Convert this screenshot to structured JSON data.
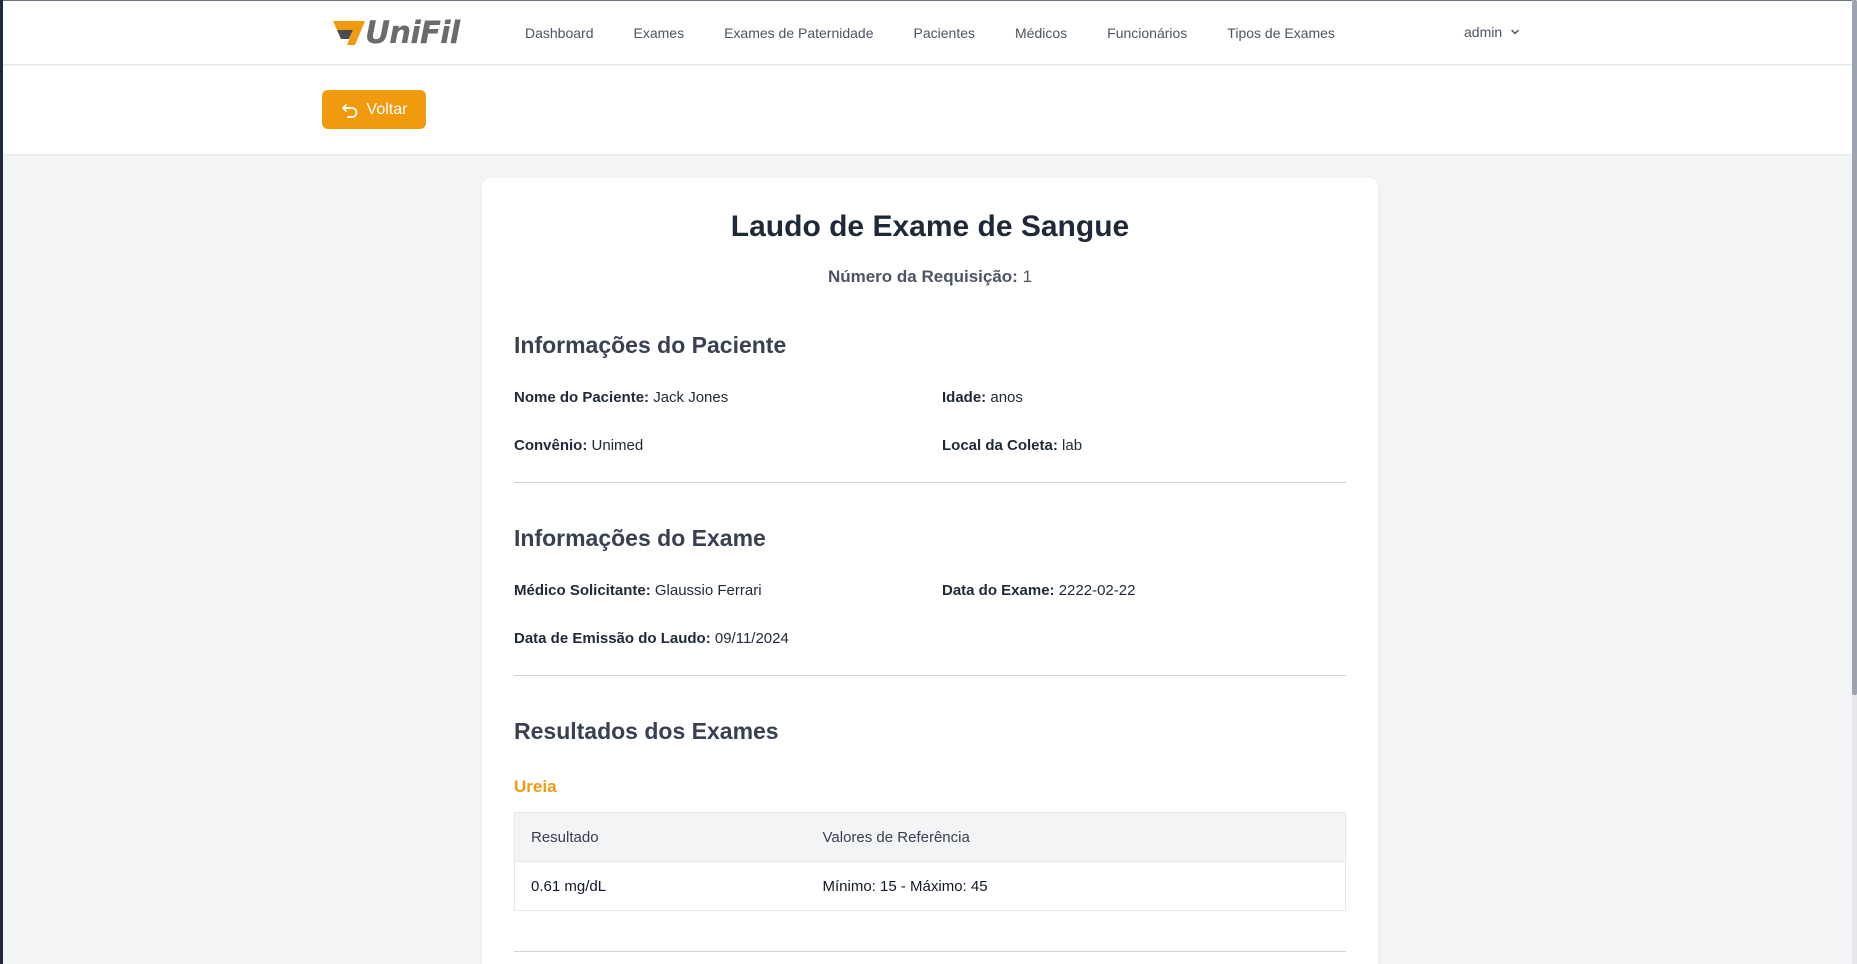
{
  "brand": {
    "name": "UniFil",
    "accent": "#f29a0e"
  },
  "nav": {
    "links": [
      "Dashboard",
      "Exames",
      "Exames de Paternidade",
      "Pacientes",
      "Médicos",
      "Funcionários",
      "Tipos de Exames"
    ],
    "user": "admin",
    "user_icon": "chevron-down-icon"
  },
  "toolbar": {
    "back_label": "Voltar",
    "back_icon": "undo-arrow-icon"
  },
  "report": {
    "title": "Laudo de Exame de Sangue",
    "requisition_label": "Número da Requisição:",
    "requisition_value": "1",
    "patient": {
      "section_title": "Informações do Paciente",
      "name_label": "Nome do Paciente:",
      "name_value": "Jack Jones",
      "age_label": "Idade:",
      "age_value": "anos",
      "insurance_label": "Convênio:",
      "insurance_value": "Unimed",
      "location_label": "Local da Coleta:",
      "location_value": "lab"
    },
    "exam": {
      "section_title": "Informações do Exame",
      "doctor_label": "Médico Solicitante:",
      "doctor_value": "Glaussio Ferrari",
      "date_label": "Data do Exame:",
      "date_value": "2222-02-22",
      "issue_label": "Data de Emissão do Laudo:",
      "issue_value": "09/11/2024"
    },
    "results": {
      "section_title": "Resultados dos Exames",
      "items": [
        {
          "name": "Ureia",
          "col_result": "Resultado",
          "col_reference": "Valores de Referência",
          "result": "0.61 mg/dL",
          "reference": "Mínimo: 15 - Máximo: 45"
        }
      ]
    }
  }
}
